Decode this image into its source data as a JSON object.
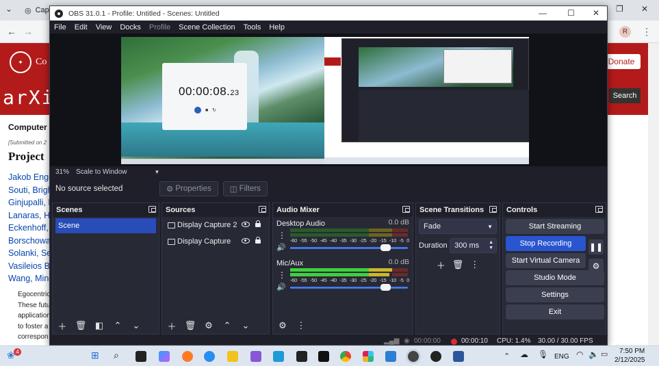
{
  "browser": {
    "tab_title": "Captu",
    "avatar_letter": "R",
    "cornell_text": "Co",
    "donate_label": "Donate",
    "arxiv_logo": "arXiv",
    "search_label": "Search",
    "subject_text": "Computer S",
    "submitted_text": "[Submitted on 2",
    "title_text": "Project",
    "authors": [
      "Jakob Enge",
      "Souti, Brigh",
      "Ginjupalli, D",
      "Lanaras, H",
      "Eckenhoff,",
      "Borschowa",
      "Solanki, Se",
      "Vasileios Ba",
      "Wang, Ming"
    ],
    "abstract_lines": [
      "Egocentric",
      "These futu",
      "application",
      "to foster a",
      "correspon"
    ]
  },
  "obs": {
    "title": "OBS 31.0.1 - Profile: Untitled - Scenes: Untitled",
    "menu": [
      "File",
      "Edit",
      "View",
      "Docks",
      "Profile",
      "Scene Collection",
      "Tools",
      "Help"
    ],
    "preview": {
      "clock_main": "00:00:08.",
      "clock_frac": "23",
      "zoom": "31%",
      "scale_label": "Scale to Window"
    },
    "context": {
      "no_source": "No source selected",
      "properties_label": "Properties",
      "filters_label": "Filters"
    },
    "scenes": {
      "title": "Scenes",
      "items": [
        "Scene"
      ]
    },
    "sources": {
      "title": "Sources",
      "items": [
        "Display Capture 2",
        "Display Capture"
      ]
    },
    "mixer": {
      "title": "Audio Mixer",
      "channels": [
        {
          "name": "Desktop Audio",
          "db": "0.0 dB",
          "volume": 0.93
        },
        {
          "name": "Mic/Aux",
          "db": "0.0 dB",
          "volume": 0.93
        }
      ],
      "ticks": [
        "-60",
        "-55",
        "-50",
        "-45",
        "-40",
        "-35",
        "-30",
        "-25",
        "-20",
        "-15",
        "-10",
        "-5",
        "0"
      ]
    },
    "transitions": {
      "title": "Scene Transitions",
      "selected": "Fade",
      "duration_label": "Duration",
      "duration_value": "300 ms"
    },
    "controls": {
      "title": "Controls",
      "start_streaming": "Start Streaming",
      "stop_recording": "Stop Recording",
      "start_virtual_camera": "Start Virtual Camera",
      "studio_mode": "Studio Mode",
      "settings": "Settings",
      "exit": "Exit"
    },
    "status": {
      "stream_time": "00:00:00",
      "rec_time": "00:00:10",
      "cpu": "CPU: 1.4%",
      "fps": "30.00 / 30.00 FPS"
    },
    "colors": {
      "accent": "#2a55d0",
      "background": "#1e1f29",
      "dock": "#272935",
      "rec": "#e02a2a"
    }
  },
  "taskbar": {
    "notification_count": "4",
    "language": "ENG",
    "time": "7:50 PM",
    "date": "2/12/2025"
  }
}
